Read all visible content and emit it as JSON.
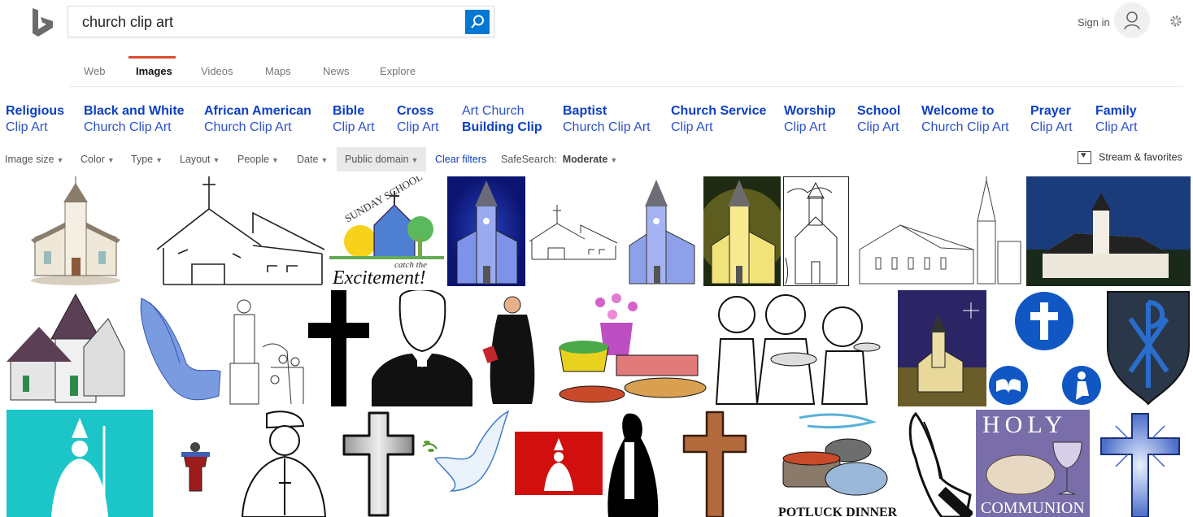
{
  "search": {
    "query": "church clip art"
  },
  "header": {
    "signin_label": "Sign in"
  },
  "tabs": [
    "Web",
    "Images",
    "Videos",
    "Maps",
    "News",
    "Explore"
  ],
  "related": [
    {
      "line1": "Religious",
      "line2": "Clip Art"
    },
    {
      "line1": "Black and White",
      "line2": "Church Clip Art"
    },
    {
      "line1": "African American",
      "line2": "Church Clip Art"
    },
    {
      "line1": "Bible",
      "line2": "Clip Art"
    },
    {
      "line1": "Cross",
      "line2": "Clip Art"
    },
    {
      "line1": "Art Church",
      "line2": "Building Clip"
    },
    {
      "line1": "Baptist",
      "line2": "Church Clip Art"
    },
    {
      "line1": "Church Service",
      "line2": "Clip Art"
    },
    {
      "line1": "Worship",
      "line2": "Clip Art"
    },
    {
      "line1": "School",
      "line2": "Clip Art"
    },
    {
      "line1": "Welcome to",
      "line2": "Church Clip Art"
    },
    {
      "line1": "Prayer",
      "line2": "Clip Art"
    },
    {
      "line1": "Family",
      "line2": "Clip Art"
    }
  ],
  "filters": {
    "image_size": "Image size",
    "color": "Color",
    "type": "Type",
    "layout": "Layout",
    "people": "People",
    "date": "Date",
    "license": "Public domain",
    "clear": "Clear filters",
    "safesearch_label": "SafeSearch:",
    "safesearch_value": "Moderate",
    "stream": "Stream & favorites"
  },
  "image_texts": {
    "sunday_school": "SUNDAY SCHOOL",
    "catch_the": "catch the",
    "excitement": "Excitement!",
    "potluck": "POTLUCK DINNER",
    "holy": "HOLY",
    "communion": "COMMUNION"
  },
  "icons": [
    "bing-logo",
    "search-icon",
    "avatar-icon",
    "gear-icon",
    "stream-favorites-icon"
  ],
  "colors": {
    "accent": "#0078d4",
    "tab_underline": "#de4c2f",
    "link": "#0c3fc4"
  }
}
